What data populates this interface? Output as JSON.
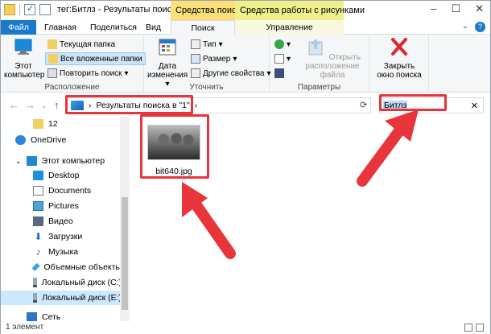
{
  "window": {
    "title": "тег:Битлз - Результаты поиска",
    "context_tabs": {
      "search": "Средства поиска",
      "images": "Средства работы с рисунками"
    }
  },
  "tabs": {
    "file": "Файл",
    "home": "Главная",
    "share": "Поделиться",
    "view": "Вид",
    "search": "Поиск",
    "manage": "Управление"
  },
  "ribbon": {
    "location": {
      "label": "Расположение",
      "this_pc": "Этот\nкомпьютер",
      "current_folder": "Текущая папка",
      "all_subfolders": "Все вложенные папки",
      "search_again": "Повторить поиск"
    },
    "refine": {
      "label": "Уточнить",
      "date_modified": "Дата\nизменения",
      "type": "Тип",
      "size": "Размер",
      "other_props": "Другие свойства"
    },
    "options": {
      "label": "Параметры",
      "open_location": "Открыть\nрасположение файла"
    },
    "close": {
      "close_search": "Закрыть\nокно поиска"
    }
  },
  "address": {
    "path": "Результаты поиска в \"1\"",
    "search_value": "Битлз"
  },
  "nav": {
    "items": [
      {
        "label": "12",
        "icon": "folder-icon"
      },
      {
        "label": "OneDrive",
        "icon": "cloud-icon"
      },
      {
        "label": "Этот компьютер",
        "icon": "computer-icon"
      },
      {
        "label": "Desktop",
        "icon": "desktop-icon"
      },
      {
        "label": "Documents",
        "icon": "documents-icon"
      },
      {
        "label": "Pictures",
        "icon": "pictures-icon"
      },
      {
        "label": "Видео",
        "icon": "video-icon"
      },
      {
        "label": "Загрузки",
        "icon": "downloads-icon"
      },
      {
        "label": "Музыка",
        "icon": "music-icon"
      },
      {
        "label": "Объемные объекты",
        "icon": "3d-objects-icon"
      },
      {
        "label": "Локальный диск (C:)",
        "icon": "disk-icon"
      },
      {
        "label": "Локальный диск (E:)",
        "icon": "disk-icon"
      },
      {
        "label": "Сеть",
        "icon": "network-icon"
      }
    ]
  },
  "content": {
    "files": [
      {
        "name": "bit640.jpg"
      }
    ]
  },
  "status": {
    "count": "1 элемент"
  },
  "colors": {
    "accent": "#1979ca",
    "annotation": "#e8353c",
    "search_tab": "#fbe07a",
    "images_tab": "#eff08b"
  }
}
